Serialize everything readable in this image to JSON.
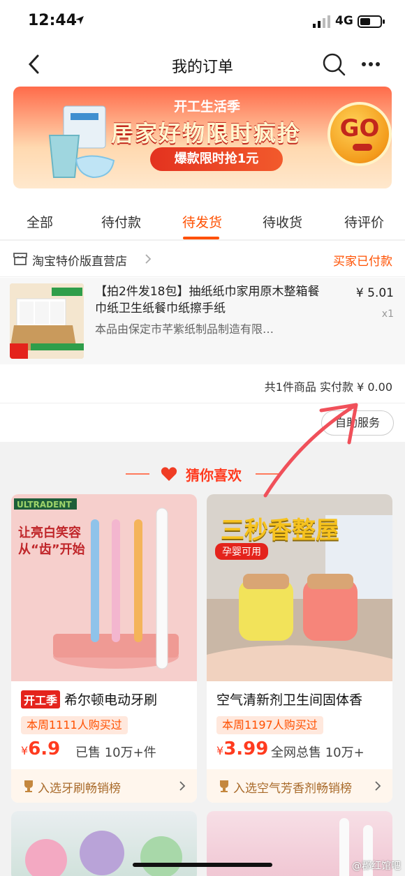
{
  "status_bar": {
    "time": "12:44",
    "network": "4G"
  },
  "nav": {
    "title": "我的订单"
  },
  "banner": {
    "subtitle": "开工生活季",
    "headline": "居家好物限时疯抢",
    "pill": "爆款限时抢1元",
    "go": "GO"
  },
  "tabs": [
    {
      "label": "全部"
    },
    {
      "label": "待付款"
    },
    {
      "label": "待发货",
      "active": true
    },
    {
      "label": "待收货"
    },
    {
      "label": "待评价"
    }
  ],
  "order": {
    "shop_name": "淘宝特价版直营店",
    "status": "买家已付款",
    "item": {
      "title": "【拍2件发18包】抽纸纸巾家用原木整箱餐巾纸卫生纸餐巾纸擦手纸",
      "desc": "本品由保定市芊紫纸制品制造有限…",
      "price": "¥ 5.01",
      "qty": "x1"
    },
    "summary": "共1件商品 实付款 ¥ 0.00",
    "service_button": "自助服务"
  },
  "guess": {
    "title": "猜你喜欢"
  },
  "products": [
    {
      "tag": "开工季",
      "name": "希尔顿电动牙刷",
      "buyers": "本周1111人购买过",
      "price_symbol": "¥",
      "price": "6.9",
      "sold": "已售 10万+件",
      "rank": "入选牙刷畅销榜",
      "img_text": "让亮白笑容 从“齿”开始",
      "brand": "ULTRADENT"
    },
    {
      "tag": "",
      "name": "空气清新剂卫生间固体香",
      "buyers": "本周1197人购买过",
      "price_symbol": "¥",
      "price": "3.99",
      "sold": "全网总售 10万+",
      "rank": "入选空气芳香剂畅销榜",
      "img_text": "三秒香整屋",
      "img_badge": "孕婴可用"
    }
  ],
  "watermark": "@郡红馆吧",
  "colors": {
    "accent": "#ff5000",
    "red": "#e4231c",
    "annotation": "#f0505a"
  }
}
